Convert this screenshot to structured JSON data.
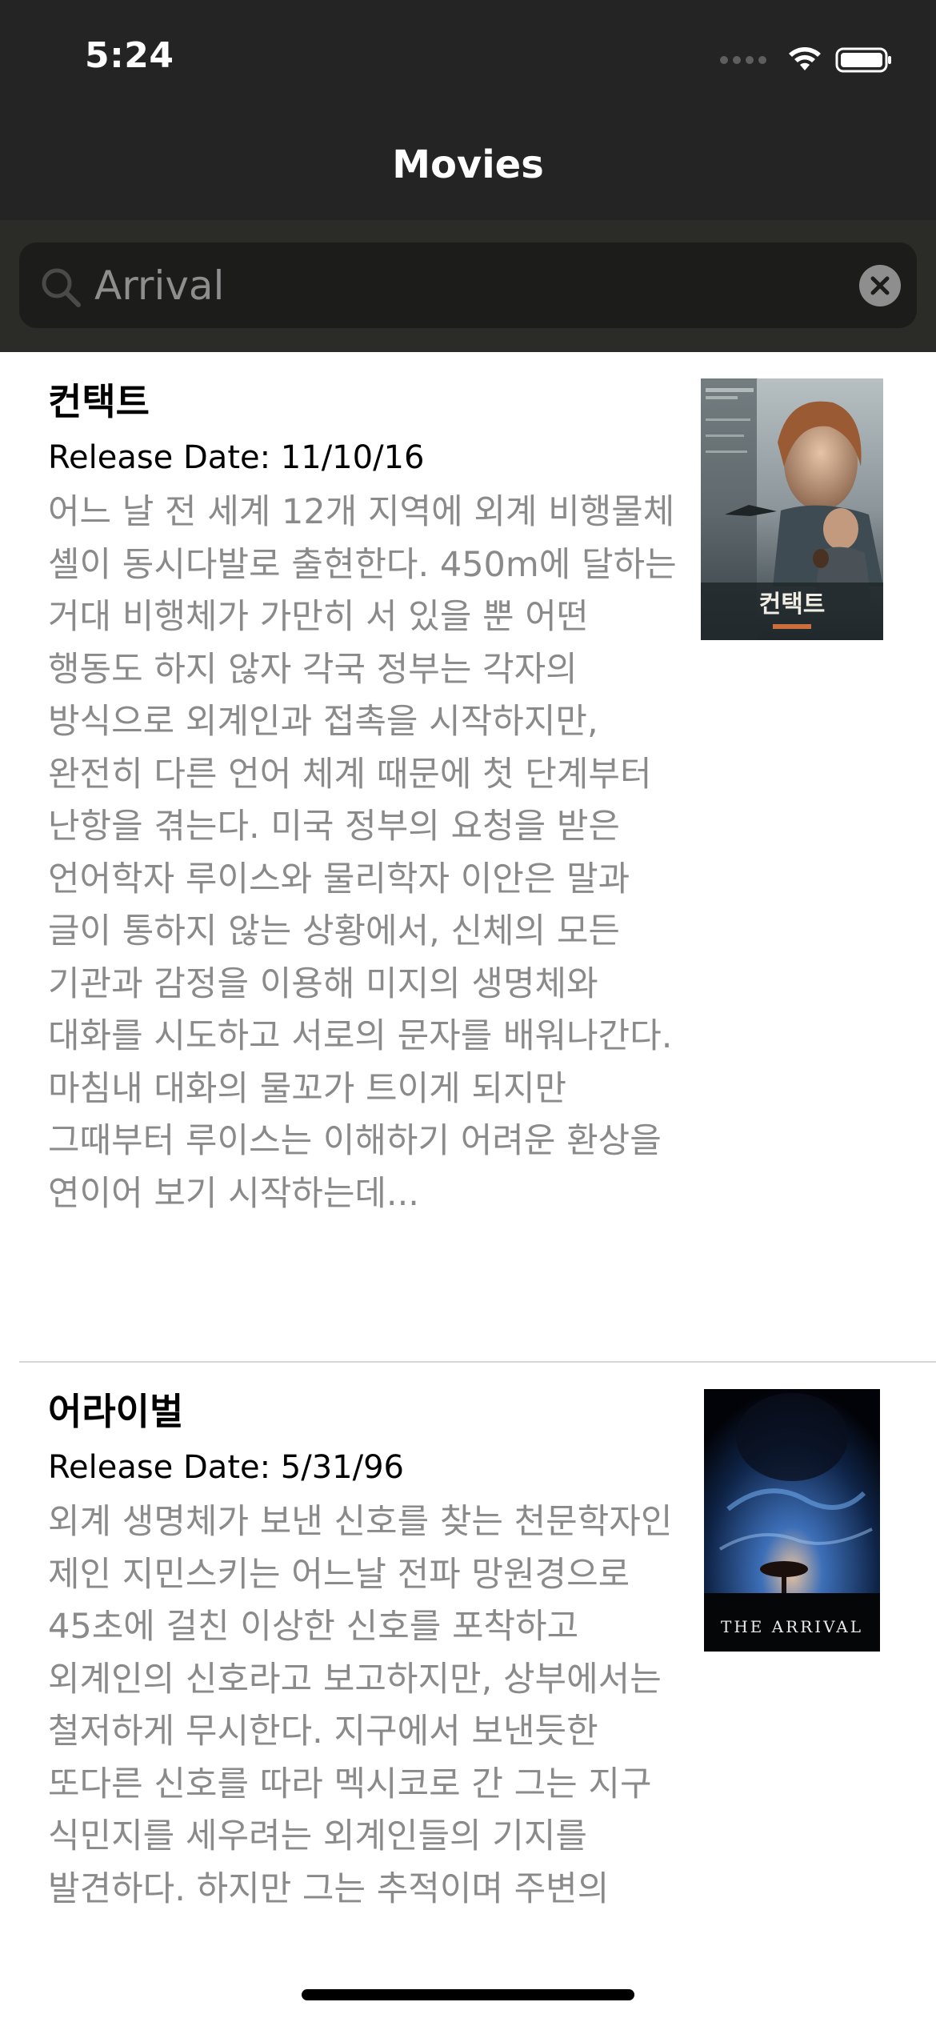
{
  "status_bar": {
    "time": "5:24"
  },
  "nav": {
    "title": "Movies"
  },
  "search": {
    "query": "Arrival"
  },
  "movies": [
    {
      "title": "컨택트",
      "release": "Release Date: 11/10/16",
      "overview": "어느 날 전 세계 12개 지역에 외계 비행물체 셸이 동시다발로 출현한다. 450m에 달하는 거대 비행체가 가만히 서 있을 뿐 어떤 행동도 하지 않자 각국 정부는 각자의 방식으로 외계인과 접촉을 시작하지만, 완전히 다른 언어 체계 때문에 첫 단계부터 난항을 겪는다. 미국 정부의 요청을 받은 언어학자 루이스와 물리학자 이안은 말과 글이 통하지 않는 상황에서, 신체의 모든 기관과 감정을 이용해 미지의 생명체와 대화를 시도하고 서로의 문자를 배워나간다. 마침내 대화의 물꼬가 트이게 되지만 그때부터 루이스는 이해하기 어려운 환상을 연이어 보기 시작하는데...",
      "poster_title": "컨택트"
    },
    {
      "title": "어라이벌",
      "release": "Release Date: 5/31/96",
      "overview": "외계 생명체가 보낸 신호를 찾는 천문학자인 제인 지민스키는 어느날 전파 망원경으로 45초에 걸친 이상한 신호를 포착하고 외계인의 신호라고 보고하지만, 상부에서는 철저하게 무시한다. 지구에서 보낸듯한 또다른 신호를 따라 멕시코로 간 그는 지구 식민지를 세우려는 외계인들의 기지를 발견하다. 하지만 그는 추적이며 주변의",
      "poster_title": "THE ARRIVAL"
    }
  ],
  "colors": {
    "bar_background": "#242424",
    "search_area": "#2b2b28",
    "search_field": "#1c1c1a",
    "overview_text": "#8a8a8a"
  }
}
